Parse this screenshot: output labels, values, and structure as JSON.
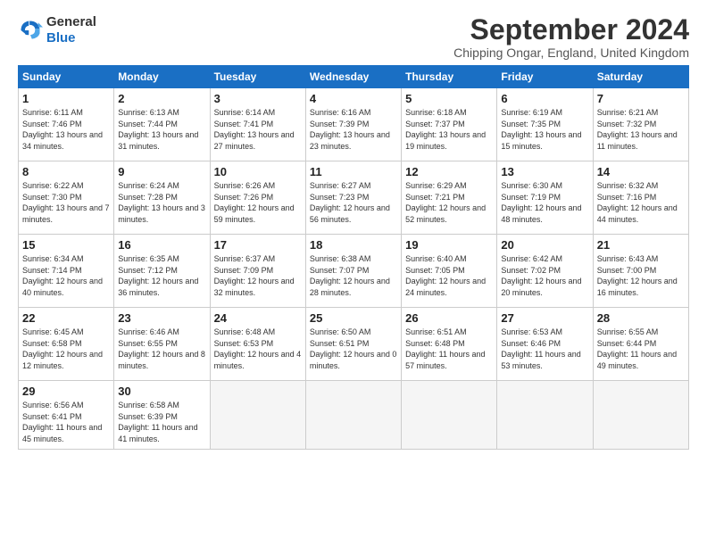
{
  "header": {
    "logo_line1": "General",
    "logo_line2": "Blue",
    "month_title": "September 2024",
    "location": "Chipping Ongar, England, United Kingdom"
  },
  "days_of_week": [
    "Sunday",
    "Monday",
    "Tuesday",
    "Wednesday",
    "Thursday",
    "Friday",
    "Saturday"
  ],
  "weeks": [
    [
      {
        "day": "1",
        "sunrise": "6:11 AM",
        "sunset": "7:46 PM",
        "daylight": "13 hours and 34 minutes."
      },
      {
        "day": "2",
        "sunrise": "6:13 AM",
        "sunset": "7:44 PM",
        "daylight": "13 hours and 31 minutes."
      },
      {
        "day": "3",
        "sunrise": "6:14 AM",
        "sunset": "7:41 PM",
        "daylight": "13 hours and 27 minutes."
      },
      {
        "day": "4",
        "sunrise": "6:16 AM",
        "sunset": "7:39 PM",
        "daylight": "13 hours and 23 minutes."
      },
      {
        "day": "5",
        "sunrise": "6:18 AM",
        "sunset": "7:37 PM",
        "daylight": "13 hours and 19 minutes."
      },
      {
        "day": "6",
        "sunrise": "6:19 AM",
        "sunset": "7:35 PM",
        "daylight": "13 hours and 15 minutes."
      },
      {
        "day": "7",
        "sunrise": "6:21 AM",
        "sunset": "7:32 PM",
        "daylight": "13 hours and 11 minutes."
      }
    ],
    [
      {
        "day": "8",
        "sunrise": "6:22 AM",
        "sunset": "7:30 PM",
        "daylight": "13 hours and 7 minutes."
      },
      {
        "day": "9",
        "sunrise": "6:24 AM",
        "sunset": "7:28 PM",
        "daylight": "13 hours and 3 minutes."
      },
      {
        "day": "10",
        "sunrise": "6:26 AM",
        "sunset": "7:26 PM",
        "daylight": "12 hours and 59 minutes."
      },
      {
        "day": "11",
        "sunrise": "6:27 AM",
        "sunset": "7:23 PM",
        "daylight": "12 hours and 56 minutes."
      },
      {
        "day": "12",
        "sunrise": "6:29 AM",
        "sunset": "7:21 PM",
        "daylight": "12 hours and 52 minutes."
      },
      {
        "day": "13",
        "sunrise": "6:30 AM",
        "sunset": "7:19 PM",
        "daylight": "12 hours and 48 minutes."
      },
      {
        "day": "14",
        "sunrise": "6:32 AM",
        "sunset": "7:16 PM",
        "daylight": "12 hours and 44 minutes."
      }
    ],
    [
      {
        "day": "15",
        "sunrise": "6:34 AM",
        "sunset": "7:14 PM",
        "daylight": "12 hours and 40 minutes."
      },
      {
        "day": "16",
        "sunrise": "6:35 AM",
        "sunset": "7:12 PM",
        "daylight": "12 hours and 36 minutes."
      },
      {
        "day": "17",
        "sunrise": "6:37 AM",
        "sunset": "7:09 PM",
        "daylight": "12 hours and 32 minutes."
      },
      {
        "day": "18",
        "sunrise": "6:38 AM",
        "sunset": "7:07 PM",
        "daylight": "12 hours and 28 minutes."
      },
      {
        "day": "19",
        "sunrise": "6:40 AM",
        "sunset": "7:05 PM",
        "daylight": "12 hours and 24 minutes."
      },
      {
        "day": "20",
        "sunrise": "6:42 AM",
        "sunset": "7:02 PM",
        "daylight": "12 hours and 20 minutes."
      },
      {
        "day": "21",
        "sunrise": "6:43 AM",
        "sunset": "7:00 PM",
        "daylight": "12 hours and 16 minutes."
      }
    ],
    [
      {
        "day": "22",
        "sunrise": "6:45 AM",
        "sunset": "6:58 PM",
        "daylight": "12 hours and 12 minutes."
      },
      {
        "day": "23",
        "sunrise": "6:46 AM",
        "sunset": "6:55 PM",
        "daylight": "12 hours and 8 minutes."
      },
      {
        "day": "24",
        "sunrise": "6:48 AM",
        "sunset": "6:53 PM",
        "daylight": "12 hours and 4 minutes."
      },
      {
        "day": "25",
        "sunrise": "6:50 AM",
        "sunset": "6:51 PM",
        "daylight": "12 hours and 0 minutes."
      },
      {
        "day": "26",
        "sunrise": "6:51 AM",
        "sunset": "6:48 PM",
        "daylight": "11 hours and 57 minutes."
      },
      {
        "day": "27",
        "sunrise": "6:53 AM",
        "sunset": "6:46 PM",
        "daylight": "11 hours and 53 minutes."
      },
      {
        "day": "28",
        "sunrise": "6:55 AM",
        "sunset": "6:44 PM",
        "daylight": "11 hours and 49 minutes."
      }
    ],
    [
      {
        "day": "29",
        "sunrise": "6:56 AM",
        "sunset": "6:41 PM",
        "daylight": "11 hours and 45 minutes."
      },
      {
        "day": "30",
        "sunrise": "6:58 AM",
        "sunset": "6:39 PM",
        "daylight": "11 hours and 41 minutes."
      },
      null,
      null,
      null,
      null,
      null
    ]
  ]
}
